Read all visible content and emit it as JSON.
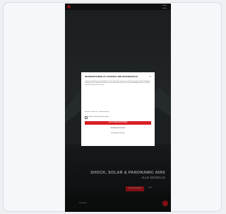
{
  "dialog": {
    "title": "INFORMATIONEN ZU COOKIES UND DATENSCHUTZ",
    "close_label": "×",
    "body_text": "Wir verwenden Cookies und ähnliche Technologien, um Ihnen ein optimales Nutzererlebnis zu bieten. Mit Ihrer Einwilligung analysieren wir die Nutzung unserer Website, um diese kontinuierlich zu verbessern und Ihnen personalisierte Inhalte und Werbung anzuzeigen. Weitere Informationen finden Sie in unserer Datenschutzerklärung. Sie können Ihre Einwilligung jederzeit mit Wirkung für die Zukunft widerrufen oder ändern.",
    "links_text": "Impressum · Datenschutz · Cookie-Einstellungen",
    "checkbox_label": "Statistik und Marketing Cookies zulassen",
    "accept_label": "ALLE COOKIES AKZEPTIEREN",
    "save_label": "AUSWAHL BESTÄTIGEN",
    "settings_label": "Einstellungen anpassen"
  },
  "hero": {
    "title": "SHOCK, SOLAR & PANORAMIC AIRS",
    "subtitle": "ALLE MODELLE",
    "cta_label": "JETZT ENTDECKEN",
    "secondary_link": "MEHR"
  },
  "footer": {
    "text": "Newsletter"
  },
  "colors": {
    "brand_red": "#c8161d",
    "dark_bg": "#1d2022"
  }
}
